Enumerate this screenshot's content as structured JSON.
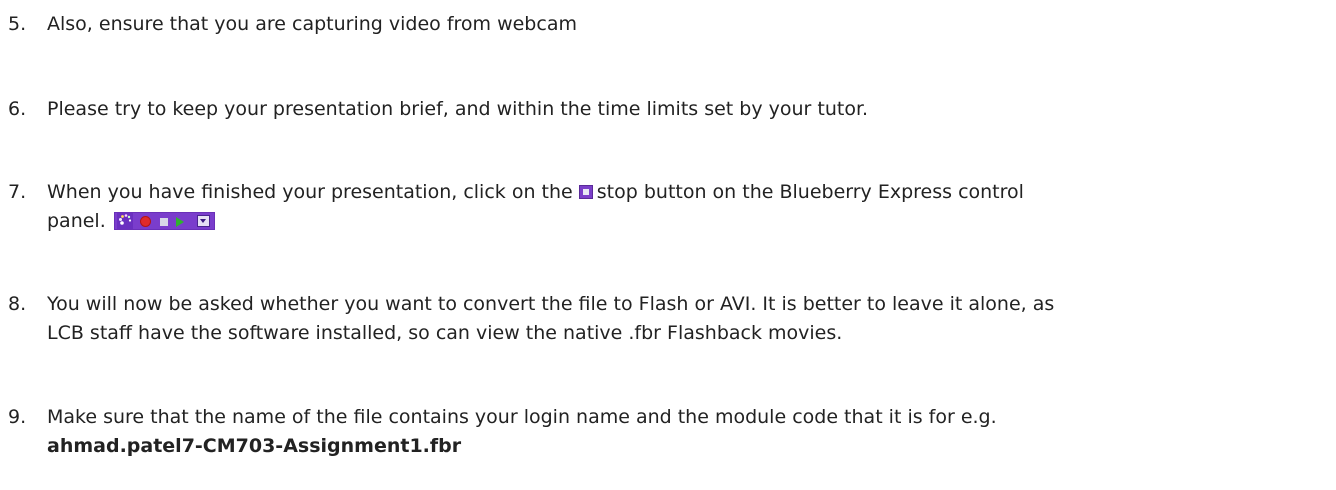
{
  "items": [
    {
      "number": "5.",
      "lines": [
        "Also, ensure that you are capturing video from webcam"
      ]
    },
    {
      "number": "6.",
      "lines": [
        "Please try to keep your presentation brief, and within the time limits set by your tutor."
      ]
    },
    {
      "number": "7.",
      "text_before_icon": "When you have finished your presentation, click on the",
      "text_after_icon": "stop button on the Blueberry Express control",
      "line2": "panel.",
      "inline_icon": "stop-button-icon",
      "toolbar_icons": [
        "flashback-logo-icon",
        "record-icon",
        "stop-icon",
        "play-icon",
        "dropdown-icon"
      ]
    },
    {
      "number": "8.",
      "lines": [
        "You will now be asked whether you want to convert the file to Flash or AVI. It is better to leave it alone, as",
        "LCB staff have the software installed, so can view the native .fbr Flashback movies."
      ]
    },
    {
      "number": "9.",
      "lines": [
        "Make sure that the name of the file contains your login name and the module code that it is for e.g."
      ],
      "bold_line": "ahmad.patel7-CM703-Assignment1.fbr"
    }
  ],
  "colors": {
    "text": "#222222",
    "toolbar_bg": "#7a3dcc",
    "record": "#e02a2a",
    "play": "#2fb32f"
  }
}
